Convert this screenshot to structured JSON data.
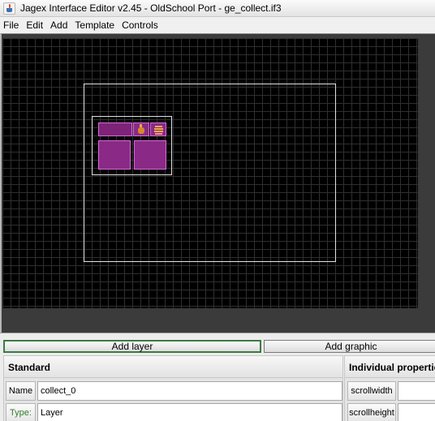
{
  "window": {
    "title": "Jagex Interface Editor v2.45 - OldSchool Port - ge_collect.if3"
  },
  "menu": {
    "items": [
      "File",
      "Edit",
      "Add",
      "Template",
      "Controls"
    ]
  },
  "toolbar": {
    "add_layer_label": "Add layer",
    "add_graphic_label": "Add graphic"
  },
  "standard": {
    "header": "Standard",
    "name_label": "Name",
    "name_value": "collect_0",
    "type_label": "Type:",
    "type_value": "Layer"
  },
  "individual": {
    "header": "Individual properties",
    "scrollwidth_label": "scrollwidth",
    "scrollwidth_value": "",
    "scrollheight_label": "scrollheight",
    "scrollheight_value": ""
  },
  "colors": {
    "canvas_background": "#000000",
    "component_fill": "#7d2479",
    "component_border": "#d86ad8",
    "selection_outline": "#e2e2e2",
    "type_label_color": "#2f7d2a",
    "add_layer_border": "#3e7a42"
  },
  "icons": {
    "app": "java-cup-icon",
    "item_1": "coin-pouch-icon",
    "item_2": "hand-grab-icon"
  }
}
